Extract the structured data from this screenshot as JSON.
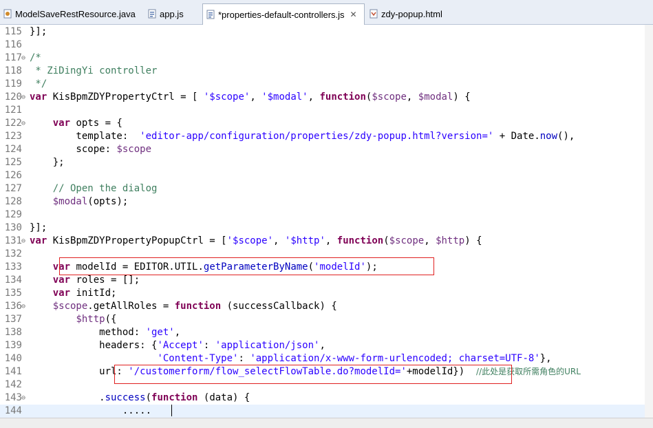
{
  "tabs": [
    {
      "label": "ModelSaveRestResource.java",
      "icon": "java-file-icon",
      "active": false
    },
    {
      "label": "app.js",
      "icon": "js-file-icon",
      "active": false
    },
    {
      "label": "*properties-default-controllers.js",
      "icon": "js-file-icon",
      "active": true
    },
    {
      "label": "zdy-popup.html",
      "icon": "html-file-icon",
      "active": false
    }
  ],
  "close_glyph": "✕",
  "fold_glyph": "⊖",
  "colors": {
    "keyword": "#7f0055",
    "string": "#2a00ff",
    "comment": "#3f7f5f",
    "variable": "#6f2f7f",
    "method": "#0000c0",
    "highlight_box": "#e02020"
  },
  "lines": [
    {
      "n": "115",
      "fold": false,
      "segs": [
        [
          "p",
          "}];"
        ]
      ]
    },
    {
      "n": "116",
      "fold": false,
      "segs": []
    },
    {
      "n": "117",
      "fold": true,
      "segs": [
        [
          "cm",
          "/*"
        ]
      ]
    },
    {
      "n": "118",
      "fold": false,
      "segs": [
        [
          "cm",
          " * ZiDingYi controller"
        ]
      ]
    },
    {
      "n": "119",
      "fold": false,
      "segs": [
        [
          "cm",
          " */"
        ]
      ]
    },
    {
      "n": "120",
      "fold": true,
      "segs": [
        [
          "kw",
          "var"
        ],
        [
          "p",
          " KisBpmZDYPropertyCtrl = [ "
        ],
        [
          "str",
          "'$scope'"
        ],
        [
          "p",
          ", "
        ],
        [
          "str",
          "'$modal'"
        ],
        [
          "p",
          ", "
        ],
        [
          "kw",
          "function"
        ],
        [
          "p",
          "("
        ],
        [
          "var",
          "$scope"
        ],
        [
          "p",
          ", "
        ],
        [
          "var",
          "$modal"
        ],
        [
          "p",
          ") {"
        ]
      ]
    },
    {
      "n": "121",
      "fold": false,
      "segs": []
    },
    {
      "n": "122",
      "fold": true,
      "segs": [
        [
          "p",
          "    "
        ],
        [
          "kw",
          "var"
        ],
        [
          "p",
          " opts = {"
        ]
      ]
    },
    {
      "n": "123",
      "fold": false,
      "segs": [
        [
          "p",
          "        template:  "
        ],
        [
          "str",
          "'editor-app/configuration/properties/zdy-popup.html?version='"
        ],
        [
          "p",
          " + Date."
        ],
        [
          "fn",
          "now"
        ],
        [
          "p",
          "(),"
        ]
      ]
    },
    {
      "n": "124",
      "fold": false,
      "segs": [
        [
          "p",
          "        scope: "
        ],
        [
          "var",
          "$scope"
        ]
      ]
    },
    {
      "n": "125",
      "fold": false,
      "segs": [
        [
          "p",
          "    };"
        ]
      ]
    },
    {
      "n": "126",
      "fold": false,
      "segs": []
    },
    {
      "n": "127",
      "fold": false,
      "segs": [
        [
          "p",
          "    "
        ],
        [
          "cm",
          "// Open the dialog"
        ]
      ]
    },
    {
      "n": "128",
      "fold": false,
      "segs": [
        [
          "p",
          "    "
        ],
        [
          "var",
          "$modal"
        ],
        [
          "p",
          "(opts);"
        ]
      ]
    },
    {
      "n": "129",
      "fold": false,
      "segs": []
    },
    {
      "n": "130",
      "fold": false,
      "segs": [
        [
          "p",
          "}];"
        ]
      ]
    },
    {
      "n": "131",
      "fold": true,
      "segs": [
        [
          "kw",
          "var"
        ],
        [
          "p",
          " KisBpmZDYPropertyPopupCtrl = ["
        ],
        [
          "str",
          "'$scope'"
        ],
        [
          "p",
          ", "
        ],
        [
          "str",
          "'$http'"
        ],
        [
          "p",
          ", "
        ],
        [
          "kw",
          "function"
        ],
        [
          "p",
          "("
        ],
        [
          "var",
          "$scope"
        ],
        [
          "p",
          ", "
        ],
        [
          "var",
          "$http"
        ],
        [
          "p",
          ") {"
        ]
      ]
    },
    {
      "n": "132",
      "fold": false,
      "segs": []
    },
    {
      "n": "133",
      "fold": false,
      "segs": [
        [
          "p",
          "    "
        ],
        [
          "kw",
          "var"
        ],
        [
          "p",
          " modelId = EDITOR.UTIL."
        ],
        [
          "fn",
          "getParameterByName"
        ],
        [
          "p",
          "("
        ],
        [
          "str",
          "'modelId'"
        ],
        [
          "p",
          ");"
        ]
      ]
    },
    {
      "n": "134",
      "fold": false,
      "segs": [
        [
          "p",
          "    "
        ],
        [
          "kw",
          "var"
        ],
        [
          "p",
          " roles = [];"
        ]
      ]
    },
    {
      "n": "135",
      "fold": false,
      "segs": [
        [
          "p",
          "    "
        ],
        [
          "kw",
          "var"
        ],
        [
          "p",
          " initId;"
        ]
      ]
    },
    {
      "n": "136",
      "fold": true,
      "segs": [
        [
          "p",
          "    "
        ],
        [
          "var",
          "$scope"
        ],
        [
          "p",
          ".getAllRoles = "
        ],
        [
          "kw",
          "function"
        ],
        [
          "p",
          " (successCallback) {"
        ]
      ]
    },
    {
      "n": "137",
      "fold": false,
      "segs": [
        [
          "p",
          "        "
        ],
        [
          "var",
          "$http"
        ],
        [
          "p",
          "({"
        ]
      ]
    },
    {
      "n": "138",
      "fold": false,
      "segs": [
        [
          "p",
          "            method: "
        ],
        [
          "str",
          "'get'"
        ],
        [
          "p",
          ","
        ]
      ]
    },
    {
      "n": "139",
      "fold": false,
      "segs": [
        [
          "p",
          "            headers: {"
        ],
        [
          "str",
          "'Accept'"
        ],
        [
          "p",
          ": "
        ],
        [
          "str",
          "'application/json'"
        ],
        [
          "p",
          ","
        ]
      ]
    },
    {
      "n": "140",
      "fold": false,
      "segs": [
        [
          "p",
          "                      "
        ],
        [
          "str",
          "'Content-Type'"
        ],
        [
          "p",
          ": "
        ],
        [
          "str",
          "'application/x-www-form-urlencoded; charset=UTF-8'"
        ],
        [
          "p",
          "},"
        ]
      ]
    },
    {
      "n": "141",
      "fold": false,
      "segs": [
        [
          "p",
          "            url: "
        ],
        [
          "str",
          "'/customerform/flow_selectFlowTable.do?modelId='"
        ],
        [
          "p",
          "+modelId})  "
        ],
        [
          "zh",
          "//此处是获取所需角色的URL"
        ]
      ]
    },
    {
      "n": "142",
      "fold": false,
      "segs": []
    },
    {
      "n": "143",
      "fold": true,
      "segs": [
        [
          "p",
          "            ."
        ],
        [
          "fn",
          "success"
        ],
        [
          "p",
          "("
        ],
        [
          "kw",
          "function"
        ],
        [
          "p",
          " (data) {"
        ]
      ]
    },
    {
      "n": "144",
      "fold": false,
      "segs": [
        [
          "p",
          "                ....."
        ]
      ],
      "current": true
    }
  ]
}
